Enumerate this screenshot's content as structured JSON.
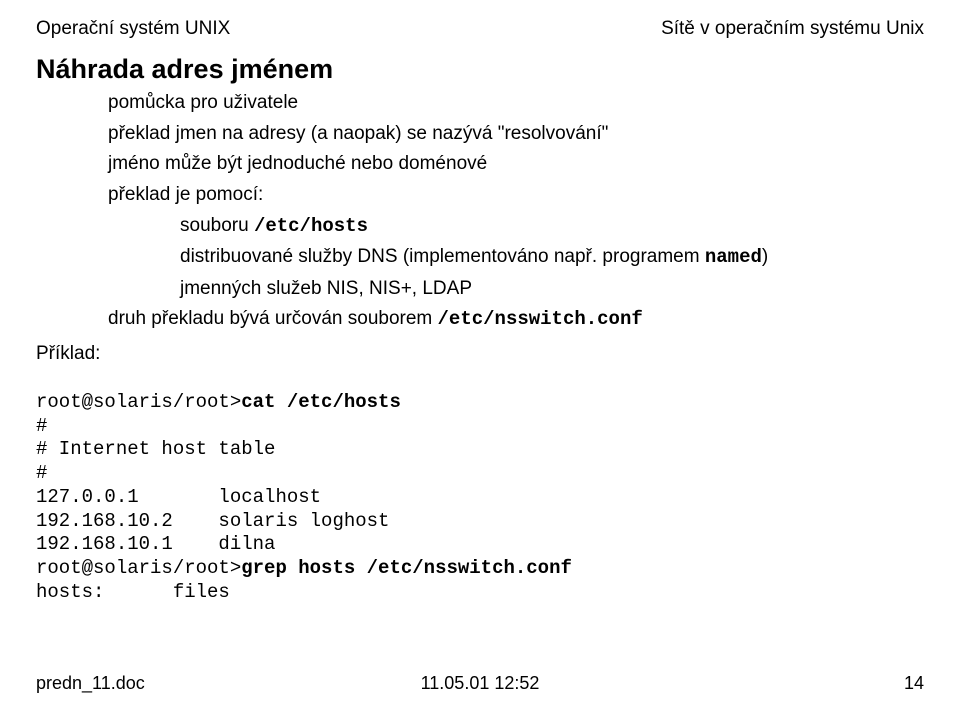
{
  "header": {
    "left": "Operační systém UNIX",
    "right": "Sítě v operačním systému Unix"
  },
  "heading": "Náhrada adres jménem",
  "b1": "pomůcka pro uživatele",
  "b2": "překlad jmen na adresy (a naopak) se nazývá \"resolvování\"",
  "b3": "jméno může být jednoduché nebo doménové",
  "b4": "překlad je pomocí:",
  "b5a": "souboru ",
  "b5b": "/etc/hosts",
  "b6a": "distribuované služby DNS (implementováno např. programem ",
  "b6b": "named",
  "b6c": ")",
  "b7": "jmenných služeb NIS, NIS+, LDAP",
  "b8a": "druh překladu bývá určován souborem ",
  "b8b": "/etc/nsswitch.conf",
  "priklad": "Příklad:",
  "code": {
    "p1a": "root@solaris/root>",
    "p1b": "cat /etc/hosts",
    "l2": "#",
    "l3": "# Internet host table",
    "l4": "#",
    "l5": "127.0.0.1       localhost",
    "l6": "192.168.10.2    solaris loghost",
    "l7": "192.168.10.1    dilna",
    "p8a": "root@solaris/root>",
    "p8b": "grep hosts /etc/nsswitch.conf",
    "l9": "hosts:      files"
  },
  "footer": {
    "left": "predn_11.doc",
    "center": "11.05.01 12:52",
    "right": "14"
  }
}
